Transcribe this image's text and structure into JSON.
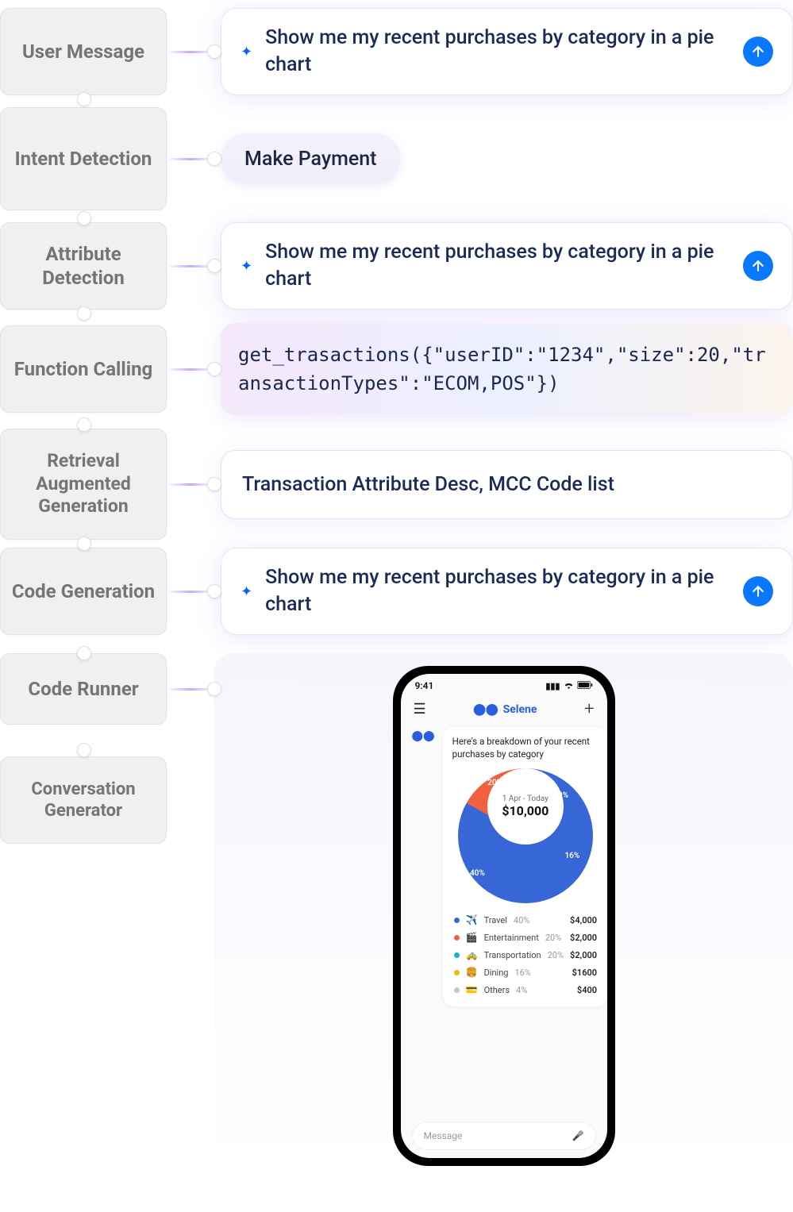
{
  "stages": {
    "user_message": "User Message",
    "intent_detection": "Intent Detection",
    "attribute_detection": "Attribute Detection",
    "function_calling": "Function Calling",
    "rag": "Retrieval Augmented Generation",
    "code_generation": "Code Generation",
    "code_runner": "Code Runner",
    "conversation_generator": "Conversation Generator"
  },
  "prompts": {
    "user_message": "Show me my recent purchases by category in a pie chart",
    "intent_pill": "Make Payment",
    "attribute_detection": "Show me my recent purchases by category in a pie chart",
    "function_call": "get_trasactions({\"userID\":\"1234\",\"size\":20,\"transactionTypes\":\"ECOM,POS\"})",
    "rag_text": "Transaction Attribute Desc, MCC Code list",
    "code_generation": "Show me my recent purchases by category in a pie chart"
  },
  "phone": {
    "time": "9:41",
    "app_name": "Selene",
    "assistant_heading": "Here's a breakdown of your recent purchases by category",
    "date_range": "1 Apr - Today",
    "total": "$10,000",
    "input_placeholder": "Message"
  },
  "chart_data": {
    "type": "pie",
    "title": "Recent purchases by category",
    "total_label": "$10,000",
    "date_range": "1 Apr - Today",
    "series": [
      {
        "name": "Travel",
        "emoji": "✈️",
        "pct": 40,
        "amount": "$4,000",
        "color": "#3766d6"
      },
      {
        "name": "Entertainment",
        "emoji": "🎬",
        "pct": 20,
        "amount": "$2,000",
        "color": "#f0613f"
      },
      {
        "name": "Transportation",
        "emoji": "🚕",
        "pct": 20,
        "amount": "$2,000",
        "color": "#14b3d1"
      },
      {
        "name": "Dining",
        "emoji": "🍔",
        "pct": 16,
        "amount": "$1600",
        "color": "#f5b60f"
      },
      {
        "name": "Others",
        "emoji": "💳",
        "pct": 4,
        "amount": "$400",
        "color": "#c7c7c7"
      }
    ],
    "visible_slice_labels": [
      "40%",
      "20%",
      "20%",
      "16%"
    ]
  }
}
